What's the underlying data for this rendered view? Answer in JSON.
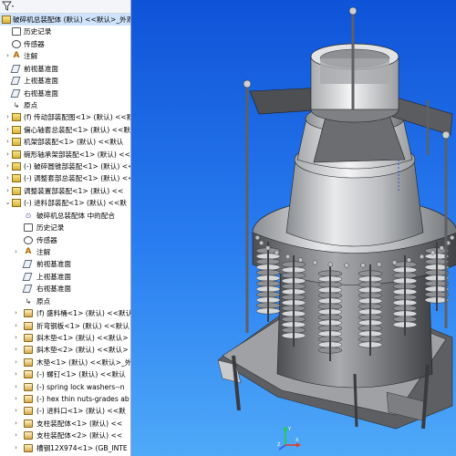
{
  "tree": {
    "filter_icon": "filter-icon",
    "items": [
      {
        "indent": 0,
        "twisty": "",
        "icon": "asm",
        "label": "破碎机总装配体 (默认) <<默认>_外观",
        "selected": true
      },
      {
        "indent": 1,
        "twisty": "",
        "icon": "hist",
        "label": "历史记录"
      },
      {
        "indent": 1,
        "twisty": "",
        "icon": "sensor",
        "label": "传感器"
      },
      {
        "indent": 1,
        "twisty": "›",
        "icon": "ann",
        "label": "注解"
      },
      {
        "indent": 1,
        "twisty": "",
        "icon": "plane",
        "label": "前视基准面"
      },
      {
        "indent": 1,
        "twisty": "",
        "icon": "plane",
        "label": "上视基准面"
      },
      {
        "indent": 1,
        "twisty": "",
        "icon": "plane",
        "label": "右视基准面"
      },
      {
        "indent": 1,
        "twisty": "",
        "icon": "origin",
        "label": "原点"
      },
      {
        "indent": 1,
        "twisty": "›",
        "icon": "asm",
        "label": "(f) 传动部装配图<1> (默认) <<默"
      },
      {
        "indent": 1,
        "twisty": "›",
        "icon": "asm",
        "label": "偏心轴套总装配<1> (默认) <<默"
      },
      {
        "indent": 1,
        "twisty": "›",
        "icon": "asm",
        "label": "机架部装配<1> (默认) <<默认"
      },
      {
        "indent": 1,
        "twisty": "›",
        "icon": "asm",
        "label": "碗形轴承架部装配<1> (默认) <<"
      },
      {
        "indent": 1,
        "twisty": "›",
        "icon": "asm",
        "label": "(-) 破碎圆锥部装配<1> (默认) <<"
      },
      {
        "indent": 1,
        "twisty": "›",
        "icon": "asm",
        "label": "(-) 调整套部总装配<1> (默认) <<"
      },
      {
        "indent": 1,
        "twisty": "›",
        "icon": "asm",
        "label": "调整装置部装配<1> (默认) <<"
      },
      {
        "indent": 1,
        "twisty": "⌄",
        "icon": "asm",
        "label": "(-) 进料部装配<1> (默认) <<默"
      },
      {
        "indent": 2,
        "twisty": "",
        "icon": "mate",
        "label": "破碎机总装配体 中的配合"
      },
      {
        "indent": 2,
        "twisty": "",
        "icon": "hist",
        "label": "历史记录"
      },
      {
        "indent": 2,
        "twisty": "",
        "icon": "sensor",
        "label": "传感器"
      },
      {
        "indent": 2,
        "twisty": "›",
        "icon": "ann",
        "label": "注解"
      },
      {
        "indent": 2,
        "twisty": "",
        "icon": "plane",
        "label": "前视基准面"
      },
      {
        "indent": 2,
        "twisty": "",
        "icon": "plane",
        "label": "上视基准面"
      },
      {
        "indent": 2,
        "twisty": "",
        "icon": "plane",
        "label": "右视基准面"
      },
      {
        "indent": 2,
        "twisty": "",
        "icon": "origin",
        "label": "原点"
      },
      {
        "indent": 2,
        "twisty": "›",
        "icon": "part",
        "label": "(f) 盛料桶<1> (默认) <<默认>"
      },
      {
        "indent": 2,
        "twisty": "›",
        "icon": "part",
        "label": "折弯钢板<1> (默认) <<默认"
      },
      {
        "indent": 2,
        "twisty": "›",
        "icon": "part",
        "label": "斜木垫<1> (默认) <<默认>"
      },
      {
        "indent": 2,
        "twisty": "›",
        "icon": "part",
        "label": "斜木垫<2> (默认) <<默认>"
      },
      {
        "indent": 2,
        "twisty": "›",
        "icon": "part",
        "label": "木垫<1> (默认) <<默认>_外"
      },
      {
        "indent": 2,
        "twisty": "›",
        "icon": "part",
        "label": "(-) 螺钉<1> (默认) <<默认"
      },
      {
        "indent": 2,
        "twisty": "›",
        "icon": "part",
        "label": "(-) spring lock washers--n"
      },
      {
        "indent": 2,
        "twisty": "›",
        "icon": "part",
        "label": "(-) hex thin nuts-grades ab"
      },
      {
        "indent": 2,
        "twisty": "›",
        "icon": "part",
        "label": "(-) 进料口<1> (默认) <<默"
      },
      {
        "indent": 2,
        "twisty": "›",
        "icon": "part",
        "label": "支柱装配体<1> (默认) <<"
      },
      {
        "indent": 2,
        "twisty": "›",
        "icon": "part",
        "label": "支柱装配体<2> (默认) <<"
      },
      {
        "indent": 2,
        "twisty": "›",
        "icon": "part",
        "label": "槽钢12X974<1> (GB_INTE"
      }
    ]
  },
  "viewport": {
    "model_name": "cone-crusher-model",
    "axes_labels": {
      "x": "X",
      "y": "Y",
      "z": "Z"
    }
  }
}
